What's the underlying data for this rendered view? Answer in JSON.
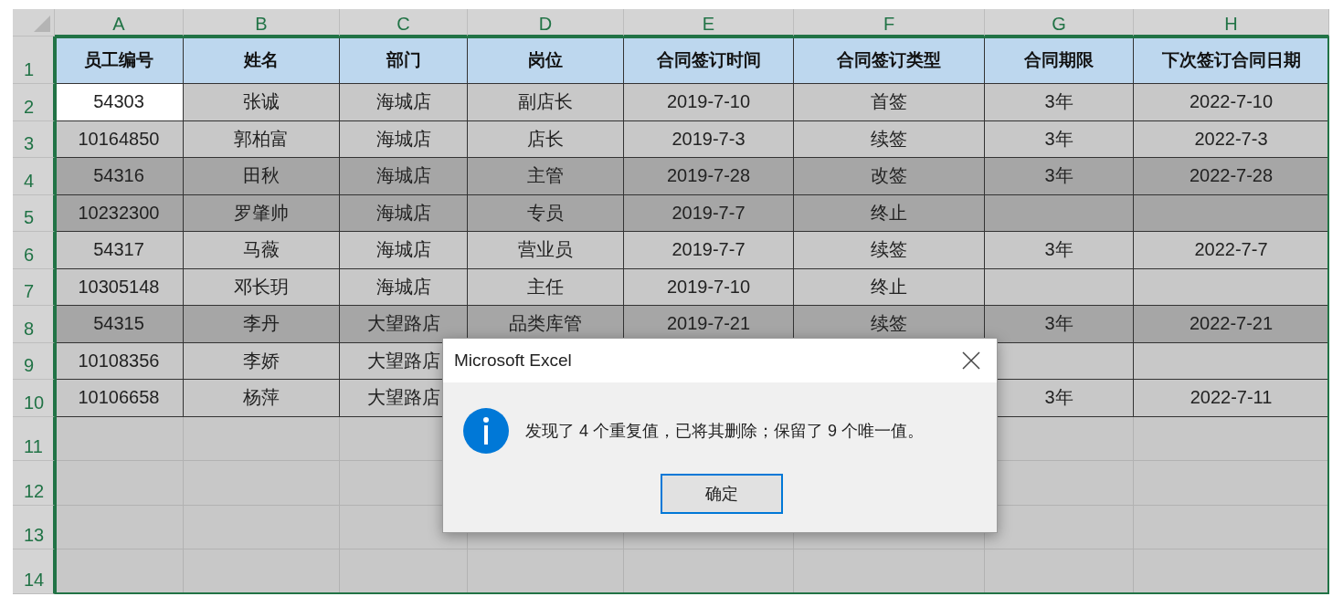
{
  "columns": [
    "A",
    "B",
    "C",
    "D",
    "E",
    "F",
    "G",
    "H"
  ],
  "header_row": {
    "row": "1",
    "cells": [
      "员工编号",
      "姓名",
      "部门",
      "岗位",
      "合同签订时间",
      "合同签订类型",
      "合同期限",
      "下次签订合同日期"
    ]
  },
  "rows": [
    {
      "row": "2",
      "highlighted": false,
      "active": true,
      "cells": [
        "54303",
        "张诚",
        "海城店",
        "副店长",
        "2019-7-10",
        "首签",
        "3年",
        "2022-7-10"
      ]
    },
    {
      "row": "3",
      "highlighted": false,
      "active": false,
      "cells": [
        "10164850",
        "郭柏富",
        "海城店",
        "店长",
        "2019-7-3",
        "续签",
        "3年",
        "2022-7-3"
      ]
    },
    {
      "row": "4",
      "highlighted": true,
      "active": false,
      "cells": [
        "54316",
        "田秋",
        "海城店",
        "主管",
        "2019-7-28",
        "改签",
        "3年",
        "2022-7-28"
      ]
    },
    {
      "row": "5",
      "highlighted": true,
      "active": false,
      "cells": [
        "10232300",
        "罗肇帅",
        "海城店",
        "专员",
        "2019-7-7",
        "终止",
        null,
        null
      ]
    },
    {
      "row": "6",
      "highlighted": false,
      "active": false,
      "cells": [
        "54317",
        "马薇",
        "海城店",
        "营业员",
        "2019-7-7",
        "续签",
        "3年",
        "2022-7-7"
      ]
    },
    {
      "row": "7",
      "highlighted": false,
      "active": false,
      "cells": [
        "10305148",
        "邓长玥",
        "海城店",
        "主任",
        "2019-7-10",
        "终止",
        null,
        null
      ]
    },
    {
      "row": "8",
      "highlighted": true,
      "active": false,
      "cells": [
        "54315",
        "李丹",
        "大望路店",
        "品类库管",
        "2019-7-21",
        "续签",
        "3年",
        "2022-7-21"
      ]
    },
    {
      "row": "9",
      "highlighted": false,
      "active": false,
      "cells": [
        "10108356",
        "李娇",
        "大望路店",
        null,
        null,
        null,
        null,
        null
      ]
    },
    {
      "row": "10",
      "highlighted": false,
      "active": false,
      "cells": [
        "10106658",
        "杨萍",
        "大望路店",
        null,
        null,
        null,
        "3年",
        "2022-7-11"
      ]
    }
  ],
  "empty_rows": [
    "11",
    "12",
    "13",
    "14"
  ],
  "dialog": {
    "title": "Microsoft Excel",
    "message": "发现了 4 个重复值，已将其删除；保留了 9 个唯一值。",
    "button": "确定"
  }
}
